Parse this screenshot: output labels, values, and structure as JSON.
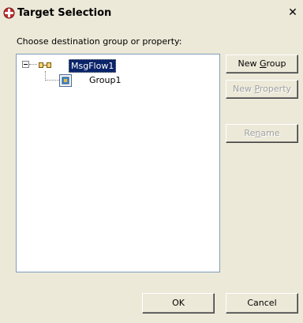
{
  "window": {
    "title": "Target Selection",
    "close_glyph": "✕",
    "icon": "target-icon"
  },
  "prompt": "Choose destination group or property:",
  "tree": {
    "nodes": [
      {
        "label": "MsgFlow1",
        "selected": true,
        "expanded": true,
        "icon": "message-flow-icon"
      },
      {
        "label": "Group1",
        "selected": false,
        "icon": "group-icon"
      }
    ]
  },
  "buttons": {
    "new_group": {
      "pre": "New ",
      "mnemonic": "G",
      "post": "roup",
      "enabled": true
    },
    "new_property": {
      "pre": "New ",
      "mnemonic": "P",
      "post": "roperty",
      "enabled": false
    },
    "rename": {
      "pre": "Re",
      "mnemonic": "n",
      "post": "ame",
      "enabled": false
    },
    "ok": "OK",
    "cancel": "Cancel"
  },
  "colors": {
    "selection_bg": "#0a246a",
    "dialog_bg": "#ece9d8",
    "tree_border": "#7f9db9"
  }
}
